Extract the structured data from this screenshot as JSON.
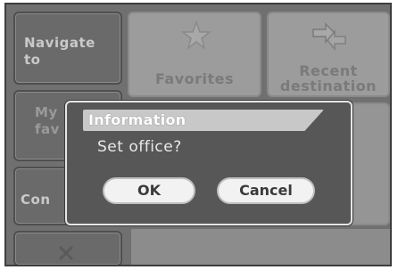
{
  "menu": {
    "navigate_to": "Navigate to",
    "my_favorites_partial": "My fav",
    "contacts_partial": "Con",
    "favorites": "Favorites",
    "recent_destination": "Recent destination"
  },
  "dialog": {
    "title": "Information",
    "message": "Set office?",
    "ok_label": "OK",
    "cancel_label": "Cancel"
  },
  "icons": {
    "favorites": "star-icon",
    "recent_destination": "arrows-icon",
    "bottom": "close-icon"
  },
  "colors": {
    "screen_bg": "#707070",
    "dialog_bg": "#575757",
    "button_bg": "#f2f2f2"
  }
}
